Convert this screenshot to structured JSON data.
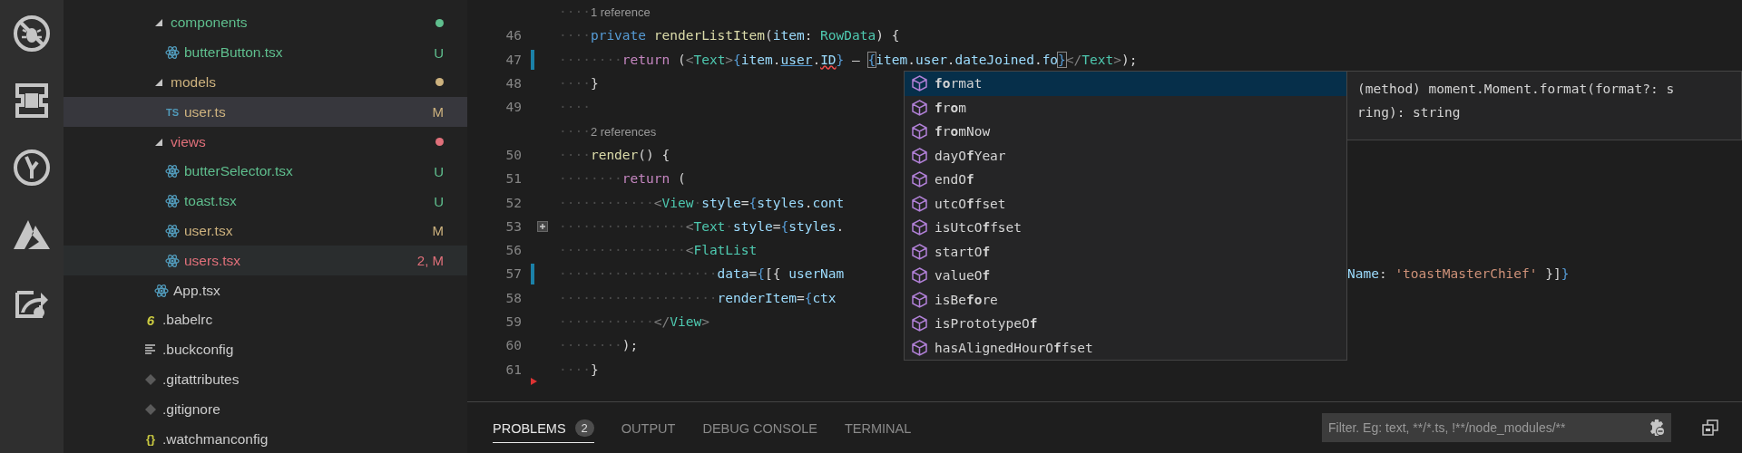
{
  "activity_bar": {
    "items": [
      {
        "kind": "no-bug"
      },
      {
        "kind": "extension"
      },
      {
        "kind": "branch"
      },
      {
        "kind": "triangle"
      },
      {
        "kind": "share"
      }
    ]
  },
  "explorer": {
    "items": [
      {
        "kind": "group",
        "children": [
          {
            "kind": "folder",
            "label": "components",
            "expanded": true,
            "color": "#5fbf8e",
            "selected": false,
            "active": false,
            "children": [
              {
                "kind": "react-file",
                "label": "butterButton.tsx",
                "status": "U",
                "color": "#5fbf8e",
                "selected": false,
                "active": false
              }
            ]
          },
          {
            "kind": "folder",
            "label": "models",
            "expanded": true,
            "color": "#cdb27e",
            "selected": false,
            "active": false,
            "children": [
              {
                "kind": "ts-file",
                "icon_text": "TS",
                "label": "user.ts",
                "status": "M",
                "color": "#cdb27e",
                "selected": true,
                "active": false
              }
            ]
          },
          {
            "kind": "folder",
            "label": "views",
            "expanded": true,
            "color": "#e0707a",
            "selected": false,
            "active": false,
            "children": [
              {
                "kind": "react-file",
                "label": "butterSelector.tsx",
                "status": "U",
                "color": "#5fbf8e",
                "selected": false,
                "active": false
              },
              {
                "kind": "react-file",
                "label": "toast.tsx",
                "status": "U",
                "color": "#5fbf8e",
                "selected": false,
                "active": false
              },
              {
                "kind": "react-file",
                "label": "user.tsx",
                "status": "M",
                "color": "#cdb27e",
                "selected": false,
                "active": false
              },
              {
                "kind": "react-file",
                "label": "users.tsx",
                "status": "2, M",
                "color": "#e0707a",
                "selected": false,
                "active": true
              }
            ]
          },
          {
            "kind": "react-file",
            "label": "App.tsx",
            "color": "#cccccc",
            "selected": false,
            "active": false
          }
        ]
      },
      {
        "kind": "babel-file",
        "icon_text": "6",
        "label": ".babelrc",
        "color": "#cccccc",
        "selected": false,
        "active": false
      },
      {
        "kind": "text-file",
        "label": ".buckconfig",
        "color": "#cccccc",
        "selected": false,
        "active": false
      },
      {
        "kind": "git-file",
        "label": ".gitattributes",
        "color": "#cccccc",
        "selected": false,
        "active": false
      },
      {
        "kind": "git-file",
        "label": ".gitignore",
        "color": "#cccccc",
        "selected": false,
        "active": false
      },
      {
        "kind": "json-file",
        "icon_text": "{}",
        "label": ".watchmanconfig",
        "color": "#cccccc",
        "selected": false,
        "active": false
      }
    ]
  },
  "editor": {
    "lines": [
      {
        "kind": "lens",
        "text": "1 reference",
        "indent": "····"
      },
      {
        "kind": "code",
        "number": "46",
        "modified": false,
        "deleted": false,
        "folded": false,
        "tokens": [
          {
            "text": "····",
            "kind": "ws"
          },
          {
            "text": "private ",
            "kind": "kw"
          },
          {
            "text": "renderListItem",
            "kind": "fn"
          },
          {
            "text": "(",
            "kind": "plain"
          },
          {
            "text": "item",
            "kind": "var"
          },
          {
            "text": ": ",
            "kind": "plain"
          },
          {
            "text": "RowData",
            "kind": "type"
          },
          {
            "text": ") {",
            "kind": "plain"
          }
        ]
      },
      {
        "kind": "code",
        "number": "47",
        "modified": true,
        "deleted": false,
        "folded": false,
        "tokens": [
          {
            "text": "········",
            "kind": "ws"
          },
          {
            "text": "return",
            "kind": "ctl"
          },
          {
            "text": " (",
            "kind": "plain"
          },
          {
            "text": "<",
            "kind": "punct"
          },
          {
            "text": "Text",
            "kind": "tag"
          },
          {
            "text": ">",
            "kind": "punct"
          },
          {
            "text": "{",
            "kind": "brace"
          },
          {
            "text": "item",
            "kind": "var"
          },
          {
            "text": ".",
            "kind": "plain"
          },
          {
            "text": "user",
            "kind": "link"
          },
          {
            "text": ".",
            "kind": "plain"
          },
          {
            "text": "ID",
            "kind": "error"
          },
          {
            "text": "}",
            "kind": "brace"
          },
          {
            "text": " – ",
            "kind": "plain"
          },
          {
            "text": "{",
            "kind": "match"
          },
          {
            "text": "item",
            "kind": "var"
          },
          {
            "text": ".",
            "kind": "plain"
          },
          {
            "text": "user",
            "kind": "var"
          },
          {
            "text": ".",
            "kind": "plain"
          },
          {
            "text": "dateJoined",
            "kind": "var"
          },
          {
            "text": ".",
            "kind": "plain"
          },
          {
            "text": "fo",
            "kind": "var"
          },
          {
            "text": "}",
            "kind": "match"
          },
          {
            "text": "</",
            "kind": "punct"
          },
          {
            "text": "Text",
            "kind": "tag"
          },
          {
            "text": ">",
            "kind": "punct"
          },
          {
            "text": ");",
            "kind": "plain"
          }
        ]
      },
      {
        "kind": "code",
        "number": "48",
        "modified": false,
        "deleted": false,
        "folded": false,
        "tokens": [
          {
            "text": "····",
            "kind": "ws"
          },
          {
            "text": "}",
            "kind": "plain"
          }
        ]
      },
      {
        "kind": "code",
        "number": "49",
        "modified": false,
        "deleted": false,
        "folded": false,
        "tokens": [
          {
            "text": "····",
            "kind": "ws"
          }
        ]
      },
      {
        "kind": "lens",
        "text": "2 references",
        "indent": "····"
      },
      {
        "kind": "code",
        "number": "50",
        "modified": false,
        "deleted": false,
        "folded": false,
        "tokens": [
          {
            "text": "····",
            "kind": "ws"
          },
          {
            "text": "render",
            "kind": "fn"
          },
          {
            "text": "() {",
            "kind": "plain"
          }
        ]
      },
      {
        "kind": "code",
        "number": "51",
        "modified": false,
        "deleted": false,
        "folded": false,
        "tokens": [
          {
            "text": "········",
            "kind": "ws"
          },
          {
            "text": "return",
            "kind": "ctl"
          },
          {
            "text": " (",
            "kind": "plain"
          }
        ]
      },
      {
        "kind": "code",
        "number": "52",
        "modified": false,
        "deleted": false,
        "folded": false,
        "tokens": [
          {
            "text": "············",
            "kind": "ws"
          },
          {
            "text": "<",
            "kind": "punct"
          },
          {
            "text": "View",
            "kind": "tag"
          },
          {
            "text": "·",
            "kind": "ws"
          },
          {
            "text": "style",
            "kind": "var"
          },
          {
            "text": "=",
            "kind": "plain"
          },
          {
            "text": "{",
            "kind": "brace"
          },
          {
            "text": "styles",
            "kind": "var"
          },
          {
            "text": ".",
            "kind": "plain"
          },
          {
            "text": "cont",
            "kind": "var"
          }
        ]
      },
      {
        "kind": "code",
        "number": "53",
        "modified": false,
        "deleted": false,
        "folded": true,
        "tokens": [
          {
            "text": "················",
            "kind": "ws"
          },
          {
            "text": "<",
            "kind": "punct"
          },
          {
            "text": "Text",
            "kind": "tag"
          },
          {
            "text": "·",
            "kind": "ws"
          },
          {
            "text": "style",
            "kind": "var"
          },
          {
            "text": "=",
            "kind": "plain"
          },
          {
            "text": "{",
            "kind": "brace"
          },
          {
            "text": "styles",
            "kind": "var"
          },
          {
            "text": ".",
            "kind": "plain"
          }
        ]
      },
      {
        "kind": "code",
        "number": "56",
        "modified": false,
        "deleted": false,
        "folded": false,
        "tokens": [
          {
            "text": "················",
            "kind": "ws"
          },
          {
            "text": "<",
            "kind": "punct"
          },
          {
            "text": "FlatList",
            "kind": "tag"
          }
        ]
      },
      {
        "kind": "code",
        "number": "57",
        "modified": true,
        "deleted": false,
        "folded": false,
        "tokens": [
          {
            "text": "····················",
            "kind": "ws"
          },
          {
            "text": "data",
            "kind": "var"
          },
          {
            "text": "=",
            "kind": "plain"
          },
          {
            "text": "{",
            "kind": "brace"
          },
          {
            "text": "[{ ",
            "kind": "plain"
          },
          {
            "text": "userNam",
            "kind": "var"
          }
        ],
        "tail": [
          {
            "text": "Name",
            "kind": "var"
          },
          {
            "text": ": ",
            "kind": "plain"
          },
          {
            "text": "'toastMasterChief'",
            "kind": "str"
          },
          {
            "text": " }]",
            "kind": "plain"
          },
          {
            "text": "}",
            "kind": "brace"
          }
        ]
      },
      {
        "kind": "code",
        "number": "58",
        "modified": false,
        "deleted": false,
        "folded": false,
        "tokens": [
          {
            "text": "····················",
            "kind": "ws"
          },
          {
            "text": "renderItem",
            "kind": "var"
          },
          {
            "text": "=",
            "kind": "plain"
          },
          {
            "text": "{",
            "kind": "brace"
          },
          {
            "text": "ctx",
            "kind": "var"
          }
        ]
      },
      {
        "kind": "code",
        "number": "59",
        "modified": false,
        "deleted": false,
        "folded": false,
        "tokens": [
          {
            "text": "············",
            "kind": "ws"
          },
          {
            "text": "</",
            "kind": "punct"
          },
          {
            "text": "View",
            "kind": "tag"
          },
          {
            "text": ">",
            "kind": "punct"
          }
        ]
      },
      {
        "kind": "code",
        "number": "60",
        "modified": false,
        "deleted": false,
        "folded": false,
        "tokens": [
          {
            "text": "········",
            "kind": "ws"
          },
          {
            "text": ");",
            "kind": "plain"
          }
        ]
      },
      {
        "kind": "code",
        "number": "61",
        "modified": false,
        "deleted": true,
        "folded": false,
        "tokens": [
          {
            "text": "····",
            "kind": "ws"
          },
          {
            "text": "}",
            "kind": "plain"
          }
        ]
      }
    ],
    "suggest": {
      "items": [
        {
          "label": "**fo**rmat",
          "selected": true
        },
        {
          "label": "**f**r**o**m",
          "selected": false
        },
        {
          "label": "**f**r**o**mNow",
          "selected": false
        },
        {
          "label": "dayO**f**Year",
          "selected": false
        },
        {
          "label": "endO**f**",
          "selected": false
        },
        {
          "label": "utcO**f**fset",
          "selected": false
        },
        {
          "label": "isUtcO**f**fset",
          "selected": false
        },
        {
          "label": "startO**f**",
          "selected": false
        },
        {
          "label": "valueO**f**",
          "selected": false
        },
        {
          "label": "isBe**fo**re",
          "selected": false
        },
        {
          "label": "isPrototypeO**f**",
          "selected": false
        },
        {
          "label": "hasAlignedHourO**f**fset",
          "selected": false
        }
      ],
      "detail": [
        "(method) moment.Moment.format(format?: s",
        "ring): string"
      ]
    }
  },
  "panel": {
    "tabs": [
      {
        "label": "PROBLEMS",
        "badge": "2",
        "selected": true
      },
      {
        "label": "OUTPUT",
        "selected": false
      },
      {
        "label": "DEBUG CONSOLE",
        "selected": false
      },
      {
        "label": "TERMINAL",
        "selected": false
      }
    ],
    "filter": {
      "placeholder": "Filter. Eg: text, **/*.ts, !**/node_modules/**"
    }
  }
}
